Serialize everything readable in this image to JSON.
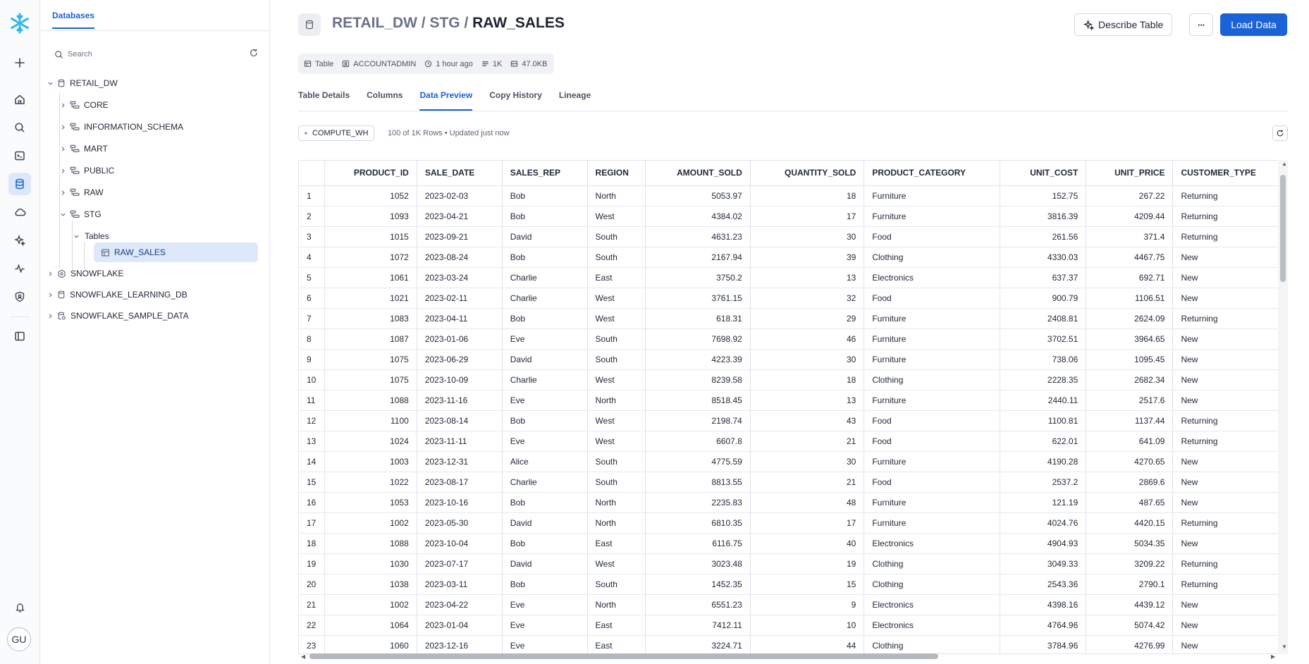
{
  "rail": {
    "user_initials": "GU"
  },
  "explorer": {
    "tab_label": "Databases",
    "search_placeholder": "Search",
    "tree": [
      {
        "label": "RETAIL_DW",
        "icon": "database-icon",
        "expanded": true
      },
      {
        "label": "CORE",
        "icon": "schema-icon"
      },
      {
        "label": "INFORMATION_SCHEMA",
        "icon": "schema-icon"
      },
      {
        "label": "MART",
        "icon": "schema-icon"
      },
      {
        "label": "PUBLIC",
        "icon": "schema-icon"
      },
      {
        "label": "RAW",
        "icon": "schema-icon"
      },
      {
        "label": "STG",
        "icon": "schema-icon",
        "expanded": true
      },
      {
        "label": "Tables",
        "icon": "none",
        "expanded": true
      },
      {
        "label": "RAW_SALES",
        "icon": "table-icon",
        "selected": true
      },
      {
        "label": "SNOWFLAKE",
        "icon": "shared-database-icon"
      },
      {
        "label": "SNOWFLAKE_LEARNING_DB",
        "icon": "database-icon"
      },
      {
        "label": "SNOWFLAKE_SAMPLE_DATA",
        "icon": "sample-database-icon"
      }
    ]
  },
  "header": {
    "path_db": "RETAIL_DW",
    "path_sep": " / ",
    "path_schema": "STG",
    "path_table": "RAW_SALES",
    "describe_label": "Describe Table",
    "more_label": "···",
    "load_label": "Load Data"
  },
  "meta": {
    "type": "Table",
    "owner": "ACCOUNTADMIN",
    "updated": "1 hour ago",
    "rows": "1K",
    "size": "47.0KB"
  },
  "tabs": [
    "Table Details",
    "Columns",
    "Data Preview",
    "Copy History",
    "Lineage"
  ],
  "active_tab": "Data Preview",
  "preview": {
    "warehouse": "COMPUTE_WH",
    "rows_info": "100 of 1K Rows • Updated just now"
  },
  "columns": [
    "PRODUCT_ID",
    "SALE_DATE",
    "SALES_REP",
    "REGION",
    "AMOUNT_SOLD",
    "QUANTITY_SOLD",
    "PRODUCT_CATEGORY",
    "UNIT_COST",
    "UNIT_PRICE",
    "CUSTOMER_TYPE"
  ],
  "rows": [
    [
      "1",
      "1052",
      "2023-02-03",
      "Bob",
      "North",
      "5053.97",
      "18",
      "Furniture",
      "152.75",
      "267.22",
      "Returning"
    ],
    [
      "2",
      "1093",
      "2023-04-21",
      "Bob",
      "West",
      "4384.02",
      "17",
      "Furniture",
      "3816.39",
      "4209.44",
      "Returning"
    ],
    [
      "3",
      "1015",
      "2023-09-21",
      "David",
      "South",
      "4631.23",
      "30",
      "Food",
      "261.56",
      "371.4",
      "Returning"
    ],
    [
      "4",
      "1072",
      "2023-08-24",
      "Bob",
      "South",
      "2167.94",
      "39",
      "Clothing",
      "4330.03",
      "4467.75",
      "New"
    ],
    [
      "5",
      "1061",
      "2023-03-24",
      "Charlie",
      "East",
      "3750.2",
      "13",
      "Electronics",
      "637.37",
      "692.71",
      "New"
    ],
    [
      "6",
      "1021",
      "2023-02-11",
      "Charlie",
      "West",
      "3761.15",
      "32",
      "Food",
      "900.79",
      "1106.51",
      "New"
    ],
    [
      "7",
      "1083",
      "2023-04-11",
      "Bob",
      "West",
      "618.31",
      "29",
      "Furniture",
      "2408.81",
      "2624.09",
      "Returning"
    ],
    [
      "8",
      "1087",
      "2023-01-06",
      "Eve",
      "South",
      "7698.92",
      "46",
      "Furniture",
      "3702.51",
      "3964.65",
      "New"
    ],
    [
      "9",
      "1075",
      "2023-06-29",
      "David",
      "South",
      "4223.39",
      "30",
      "Furniture",
      "738.06",
      "1095.45",
      "New"
    ],
    [
      "10",
      "1075",
      "2023-10-09",
      "Charlie",
      "West",
      "8239.58",
      "18",
      "Clothing",
      "2228.35",
      "2682.34",
      "New"
    ],
    [
      "11",
      "1088",
      "2023-11-16",
      "Eve",
      "North",
      "8518.45",
      "13",
      "Furniture",
      "2440.11",
      "2517.6",
      "New"
    ],
    [
      "12",
      "1100",
      "2023-08-14",
      "Bob",
      "West",
      "2198.74",
      "43",
      "Food",
      "1100.81",
      "1137.44",
      "Returning"
    ],
    [
      "13",
      "1024",
      "2023-11-11",
      "Eve",
      "West",
      "6607.8",
      "21",
      "Food",
      "622.01",
      "641.09",
      "Returning"
    ],
    [
      "14",
      "1003",
      "2023-12-31",
      "Alice",
      "South",
      "4775.59",
      "30",
      "Furniture",
      "4190.28",
      "4270.65",
      "New"
    ],
    [
      "15",
      "1022",
      "2023-08-17",
      "Charlie",
      "South",
      "8813.55",
      "21",
      "Food",
      "2537.2",
      "2869.6",
      "New"
    ],
    [
      "16",
      "1053",
      "2023-10-16",
      "Bob",
      "North",
      "2235.83",
      "48",
      "Furniture",
      "121.19",
      "487.65",
      "New"
    ],
    [
      "17",
      "1002",
      "2023-05-30",
      "David",
      "North",
      "6810.35",
      "17",
      "Furniture",
      "4024.76",
      "4420.15",
      "Returning"
    ],
    [
      "18",
      "1088",
      "2023-10-04",
      "Bob",
      "East",
      "6116.75",
      "40",
      "Electronics",
      "4904.93",
      "5034.35",
      "New"
    ],
    [
      "19",
      "1030",
      "2023-07-17",
      "David",
      "West",
      "3023.48",
      "19",
      "Clothing",
      "3049.33",
      "3209.22",
      "Returning"
    ],
    [
      "20",
      "1038",
      "2023-03-11",
      "Bob",
      "South",
      "1452.35",
      "15",
      "Clothing",
      "2543.36",
      "2790.1",
      "Returning"
    ],
    [
      "21",
      "1002",
      "2023-04-22",
      "Eve",
      "North",
      "6551.23",
      "9",
      "Electronics",
      "4398.16",
      "4439.12",
      "New"
    ],
    [
      "22",
      "1064",
      "2023-01-04",
      "Eve",
      "East",
      "7412.11",
      "10",
      "Electronics",
      "4764.96",
      "5074.42",
      "New"
    ],
    [
      "23",
      "1060",
      "2023-12-16",
      "Eve",
      "East",
      "3224.71",
      "44",
      "Clothing",
      "3784.96",
      "4276.99",
      "New"
    ]
  ],
  "colors": {
    "accent": "#1a62d6",
    "selected_bg": "#dde9fb",
    "logo": "#29b5e8"
  }
}
